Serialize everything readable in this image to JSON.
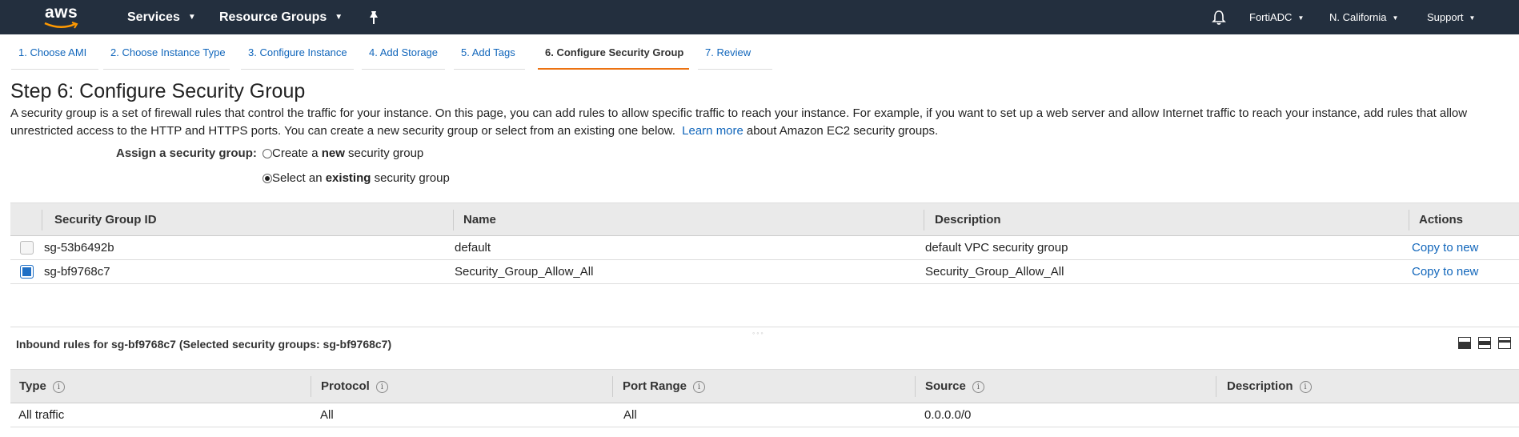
{
  "topnav": {
    "logo_text": "aws",
    "services": "Services",
    "resource_groups": "Resource Groups",
    "pin_icon": "pushpin-icon",
    "bell_icon": "bell-icon",
    "account": "FortiADC",
    "region": "N. California",
    "support": "Support",
    "caret": "▼"
  },
  "wizard": {
    "tabs": [
      {
        "label": "1. Choose AMI"
      },
      {
        "label": "2. Choose Instance Type"
      },
      {
        "label": "3. Configure Instance"
      },
      {
        "label": "4. Add Storage"
      },
      {
        "label": "5. Add Tags"
      },
      {
        "label": "6. Configure Security Group",
        "active": true
      },
      {
        "label": "7. Review"
      }
    ]
  },
  "page": {
    "title": "Step 6: Configure Security Group",
    "description_1": "A security group is a set of firewall rules that control the traffic for your instance. On this page, you can add rules to allow specific traffic to reach your instance. For example, if you want to set up a web server and allow Internet traffic to reach your instance, add rules that allow unrestricted access to the HTTP and HTTPS ports. You can create a new security group or select from an existing one below.",
    "learn_more": "Learn more",
    "description_2": "about Amazon EC2 security groups."
  },
  "assign": {
    "label": "Assign a security group:",
    "option_new_pre": "Create a ",
    "option_new_bold": "new",
    "option_new_post": " security group",
    "option_existing_pre": "Select an ",
    "option_existing_bold": "existing",
    "option_existing_post": " security group",
    "selected": "existing"
  },
  "sg_table": {
    "headers": {
      "id": "Security Group ID",
      "name": "Name",
      "description": "Description",
      "actions": "Actions"
    },
    "rows": [
      {
        "id": "sg-53b6492b",
        "name": "default",
        "description": "default VPC security group",
        "action": "Copy to new",
        "checked": false
      },
      {
        "id": "sg-bf9768c7",
        "name": "Security_Group_Allow_All",
        "description": "Security_Group_Allow_All",
        "action": "Copy to new",
        "checked": true
      }
    ]
  },
  "inbound": {
    "title": "Inbound rules for sg-bf9768c7 (Selected security groups: sg-bf9768c7)",
    "info_glyph": "i",
    "headers": {
      "type": "Type",
      "protocol": "Protocol",
      "port_range": "Port Range",
      "source": "Source",
      "description": "Description"
    },
    "rows": [
      {
        "type": "All traffic",
        "protocol": "All",
        "port_range": "All",
        "source": "0.0.0.0/0",
        "description": ""
      }
    ]
  },
  "colors": {
    "nav_bg": "#232f3e",
    "link": "#1166bb",
    "active_tab": "#ec7211",
    "checkbox": "#1f6fc5"
  }
}
